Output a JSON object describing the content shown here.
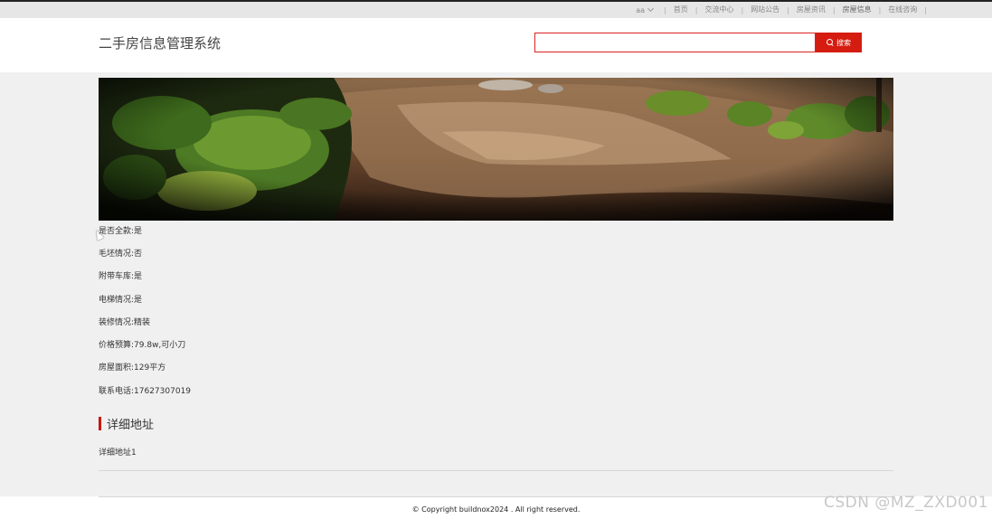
{
  "topnav": {
    "user": "aa",
    "items": [
      {
        "label": "首页",
        "active": false
      },
      {
        "label": "交流中心",
        "active": false
      },
      {
        "label": "网站公告",
        "active": false
      },
      {
        "label": "房屋资讯",
        "active": false
      },
      {
        "label": "房屋信息",
        "active": true
      },
      {
        "label": "在线咨询",
        "active": false
      }
    ],
    "active_color": "#3aa86a"
  },
  "header": {
    "title": "二手房信息管理系统",
    "search": {
      "value": "",
      "placeholder": "",
      "button_label": "搜索"
    },
    "accent_color": "#d51c10"
  },
  "details": [
    {
      "label": "是否全款:是"
    },
    {
      "label": "毛坯情况:否"
    },
    {
      "label": "附带车库:是"
    },
    {
      "label": "电梯情况:是"
    },
    {
      "label": "装修情况:精装"
    },
    {
      "label": "价格预算:79.8w,可小刀"
    },
    {
      "label": "房屋面积:129平方"
    },
    {
      "label": "联系电话:17627307019"
    }
  ],
  "address_section": {
    "title": "详细地址",
    "content": "详细地址1"
  },
  "footer": {
    "copyright": "© Copyright buildnox2024 . All right reserved."
  },
  "watermark": "CSDN @MZ_ZXD001",
  "icons": {
    "search": "search-icon",
    "user_dropdown": "chevron-down-icon"
  }
}
